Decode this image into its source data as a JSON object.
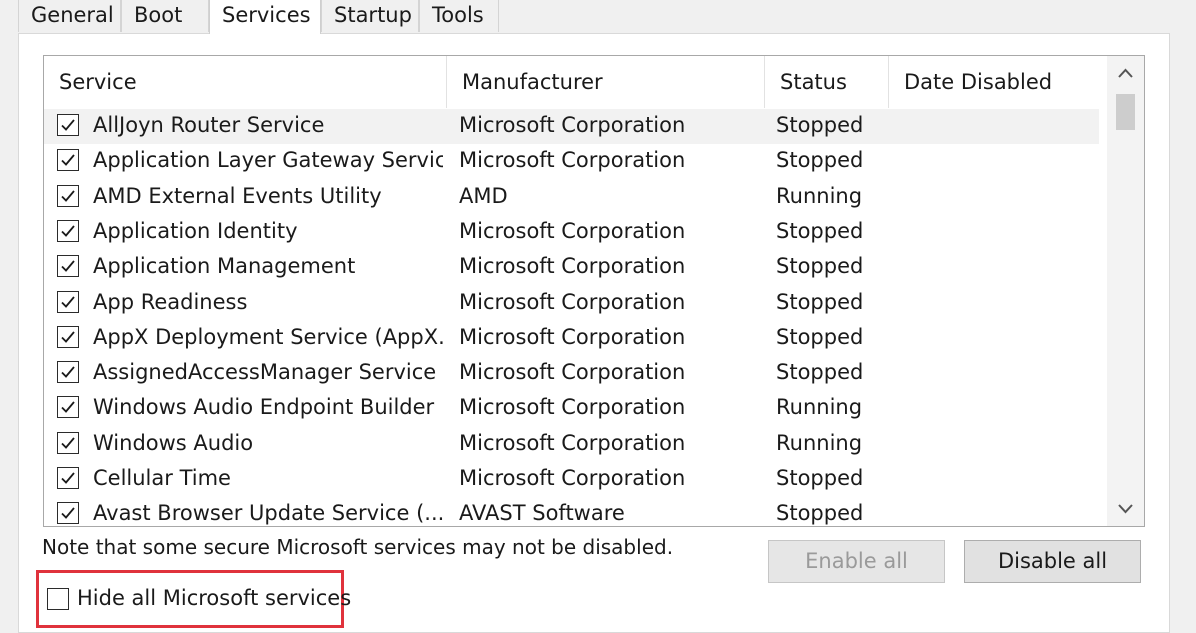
{
  "tabs": [
    {
      "label": "General",
      "active": false
    },
    {
      "label": "Boot",
      "active": false
    },
    {
      "label": "Services",
      "active": true
    },
    {
      "label": "Startup",
      "active": false
    },
    {
      "label": "Tools",
      "active": false
    }
  ],
  "columns": {
    "service": "Service",
    "manufacturer": "Manufacturer",
    "status": "Status",
    "date_disabled": "Date Disabled"
  },
  "services": [
    {
      "name": "AllJoyn Router Service",
      "manufacturer": "Microsoft Corporation",
      "status": "Stopped",
      "date_disabled": "",
      "checked": true
    },
    {
      "name": "Application Layer Gateway Service",
      "manufacturer": "Microsoft Corporation",
      "status": "Stopped",
      "date_disabled": "",
      "checked": true
    },
    {
      "name": "AMD External Events Utility",
      "manufacturer": "AMD",
      "status": "Running",
      "date_disabled": "",
      "checked": true
    },
    {
      "name": "Application Identity",
      "manufacturer": "Microsoft Corporation",
      "status": "Stopped",
      "date_disabled": "",
      "checked": true
    },
    {
      "name": "Application Management",
      "manufacturer": "Microsoft Corporation",
      "status": "Stopped",
      "date_disabled": "",
      "checked": true
    },
    {
      "name": "App Readiness",
      "manufacturer": "Microsoft Corporation",
      "status": "Stopped",
      "date_disabled": "",
      "checked": true
    },
    {
      "name": "AppX Deployment Service (AppX...",
      "manufacturer": "Microsoft Corporation",
      "status": "Stopped",
      "date_disabled": "",
      "checked": true
    },
    {
      "name": "AssignedAccessManager Service",
      "manufacturer": "Microsoft Corporation",
      "status": "Stopped",
      "date_disabled": "",
      "checked": true
    },
    {
      "name": "Windows Audio Endpoint Builder",
      "manufacturer": "Microsoft Corporation",
      "status": "Running",
      "date_disabled": "",
      "checked": true
    },
    {
      "name": "Windows Audio",
      "manufacturer": "Microsoft Corporation",
      "status": "Running",
      "date_disabled": "",
      "checked": true
    },
    {
      "name": "Cellular Time",
      "manufacturer": "Microsoft Corporation",
      "status": "Stopped",
      "date_disabled": "",
      "checked": true
    },
    {
      "name": "Avast Browser Update Service (...",
      "manufacturer": "AVAST Software",
      "status": "Stopped",
      "date_disabled": "",
      "checked": true
    }
  ],
  "note": "Note that some secure Microsoft services may not be disabled.",
  "buttons": {
    "enable_all": "Enable all",
    "disable_all": "Disable all"
  },
  "hide_ms": {
    "label": "Hide all Microsoft services",
    "checked": false
  },
  "icons": {
    "scroll_up": "chevron-up-icon",
    "scroll_down": "chevron-down-icon",
    "check": "check-icon"
  },
  "colors": {
    "highlight_border": "#e0323c"
  }
}
